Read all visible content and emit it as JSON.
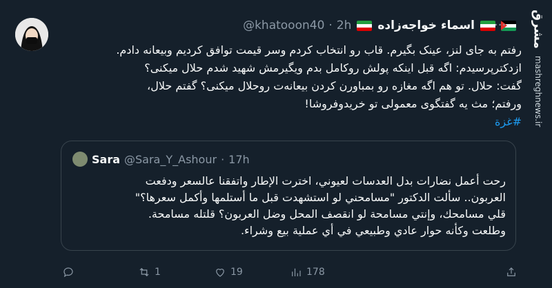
{
  "tweet": {
    "display_name": "اسماء خواجه‌زاده",
    "handle": "@khatooon40",
    "time": "2h",
    "body_lines": [
      "رفتم به جای لنز، عینک بگیرم. قاب رو انتخاب کردم وسر قیمت توافق کردیم وبیعانه دادم.",
      "ازدکترپرسیدم: اگه قبل اینکه پولش روکامل بدم ویگیرمش شهید شدم حلال میکنی؟",
      "گفت: حلال. تو هم اگه مغازه رو بمباورن کردن بیعانه‌ت روحلال میکنی؟ گفتم حلال،",
      "ورفتم؛ مث یه گفتگوی معمولی تو خریدوفروشا!"
    ],
    "hashtag": "#غزة"
  },
  "quote": {
    "name": "Sara",
    "handle": "@Sara_Y_Ashour",
    "time": "17h",
    "lines": [
      "رحت أعمل نضارات بدل العدسات لعيوني، اخترت الإطار واتفقنا عالسعر ودفعت",
      "العربون.. سألت الدكتور \"مسامحني لو استشهدت قبل ما أستلمها وأكمل سعرها؟\"",
      "قلي مسامحك، وإنتي مسامحة لو انقصف المحل وضل العربون؟ قلتله مسامحة.",
      "وطلعت وكأنه حوار عادي وطبيعي في أي عملية بيع وشراء."
    ]
  },
  "actions": {
    "replies": "",
    "retweets": "1",
    "likes": "19",
    "views": "178"
  },
  "watermark": {
    "logo": "مشرق",
    "url": "mashreghnews.ir"
  },
  "icons": {
    "more": "more-icon",
    "reply": "reply-icon",
    "retweet": "retweet-icon",
    "like": "heart-icon",
    "views": "views-icon",
    "share": "share-icon"
  }
}
